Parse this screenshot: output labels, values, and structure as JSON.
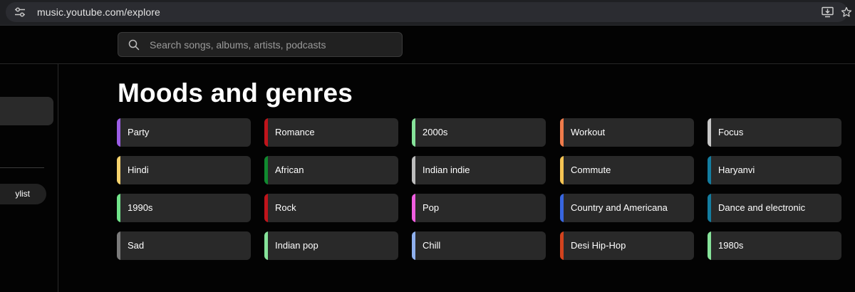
{
  "browser": {
    "url": "music.youtube.com/explore"
  },
  "search": {
    "placeholder": "Search songs, albums, artists, podcasts"
  },
  "sidebar": {
    "new_playlist_label": "ylist"
  },
  "main": {
    "title": "Moods and genres",
    "genres": [
      {
        "label": "Party",
        "color": "#9b5de5"
      },
      {
        "label": "Romance",
        "color": "#c0141b"
      },
      {
        "label": "2000s",
        "color": "#86e39a"
      },
      {
        "label": "Workout",
        "color": "#f07c4b"
      },
      {
        "label": "Focus",
        "color": "#c7c7c7"
      },
      {
        "label": "Hindi",
        "color": "#f5d26d"
      },
      {
        "label": "African",
        "color": "#10892f"
      },
      {
        "label": "Indian indie",
        "color": "#bdbdbd"
      },
      {
        "label": "Commute",
        "color": "#f6c453"
      },
      {
        "label": "Haryanvi",
        "color": "#137da0"
      },
      {
        "label": "1990s",
        "color": "#71e38a"
      },
      {
        "label": "Rock",
        "color": "#c0141b"
      },
      {
        "label": "Pop",
        "color": "#f05ee0"
      },
      {
        "label": "Country and Americana",
        "color": "#3866e0"
      },
      {
        "label": "Dance and electronic",
        "color": "#137da0"
      },
      {
        "label": "Sad",
        "color": "#7a7a7a"
      },
      {
        "label": "Indian pop",
        "color": "#86e39a"
      },
      {
        "label": "Chill",
        "color": "#8fb0ee"
      },
      {
        "label": "Desi Hip-Hop",
        "color": "#d2431e"
      },
      {
        "label": "1980s",
        "color": "#86e39a"
      }
    ]
  }
}
